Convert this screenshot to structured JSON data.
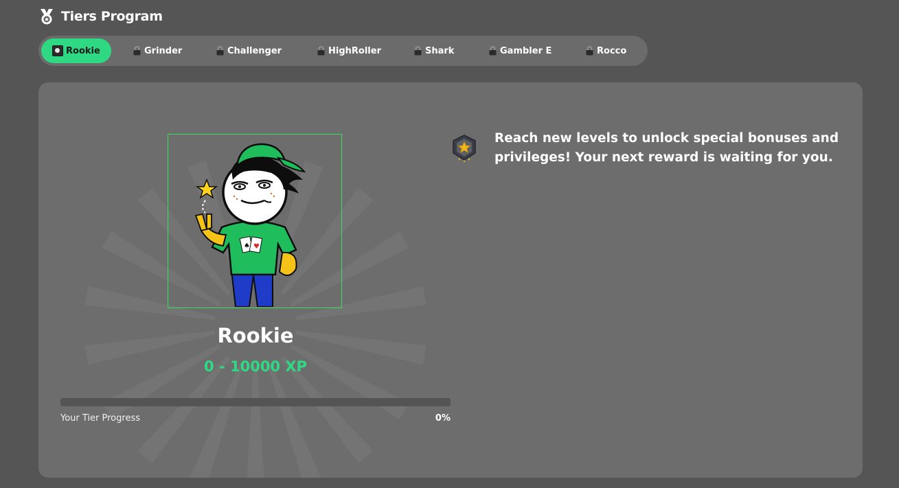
{
  "header": {
    "title": "Tiers Program",
    "icon": "medal-icon"
  },
  "tabs": [
    {
      "label": "Rookie",
      "active": true,
      "icon": "rookie-tier-icon"
    },
    {
      "label": "Grinder",
      "active": false,
      "icon": "lock-icon"
    },
    {
      "label": "Challenger",
      "active": false,
      "icon": "lock-icon"
    },
    {
      "label": "HighRoller",
      "active": false,
      "icon": "lock-icon"
    },
    {
      "label": "Shark",
      "active": false,
      "icon": "lock-icon"
    },
    {
      "label": "Gambler E",
      "active": false,
      "icon": "lock-icon"
    },
    {
      "label": "Rocco",
      "active": false,
      "icon": "lock-icon"
    }
  ],
  "tier": {
    "name": "Rookie",
    "xp_range": "0 - 10000 XP",
    "progress_label": "Your Tier Progress",
    "progress_value": "0%",
    "progress_fraction": 0
  },
  "info": {
    "text": "Reach new levels to unlock special bonuses and privileges! Your next reward is waiting for you.",
    "icon": "star-badge-icon"
  },
  "colors": {
    "accent": "#2fd984",
    "background": "#555555",
    "card": "#6d6d6d",
    "portrait_border": "#34e05a"
  }
}
